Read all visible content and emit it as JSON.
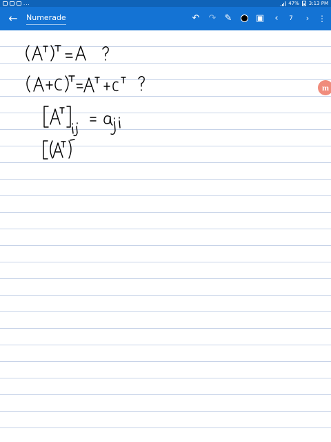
{
  "status_bar": {
    "battery": "47%",
    "time": "3:13 PM",
    "overflow": "..."
  },
  "toolbar": {
    "back_icon": "←",
    "title": "Numerade",
    "undo_icon": "↶",
    "redo_icon": "↷",
    "pen_icon": "✎",
    "image_icon": "▣",
    "prev_icon": "‹",
    "page_number": "7",
    "next_icon": "›",
    "more_icon": "⋮"
  },
  "badge": {
    "letter": "m",
    "color": "#f08c7c"
  },
  "colors": {
    "status_bar": "#0f63b8",
    "toolbar": "#1473d4",
    "rule_line": "#c7d3e8",
    "ink": "#000000"
  }
}
